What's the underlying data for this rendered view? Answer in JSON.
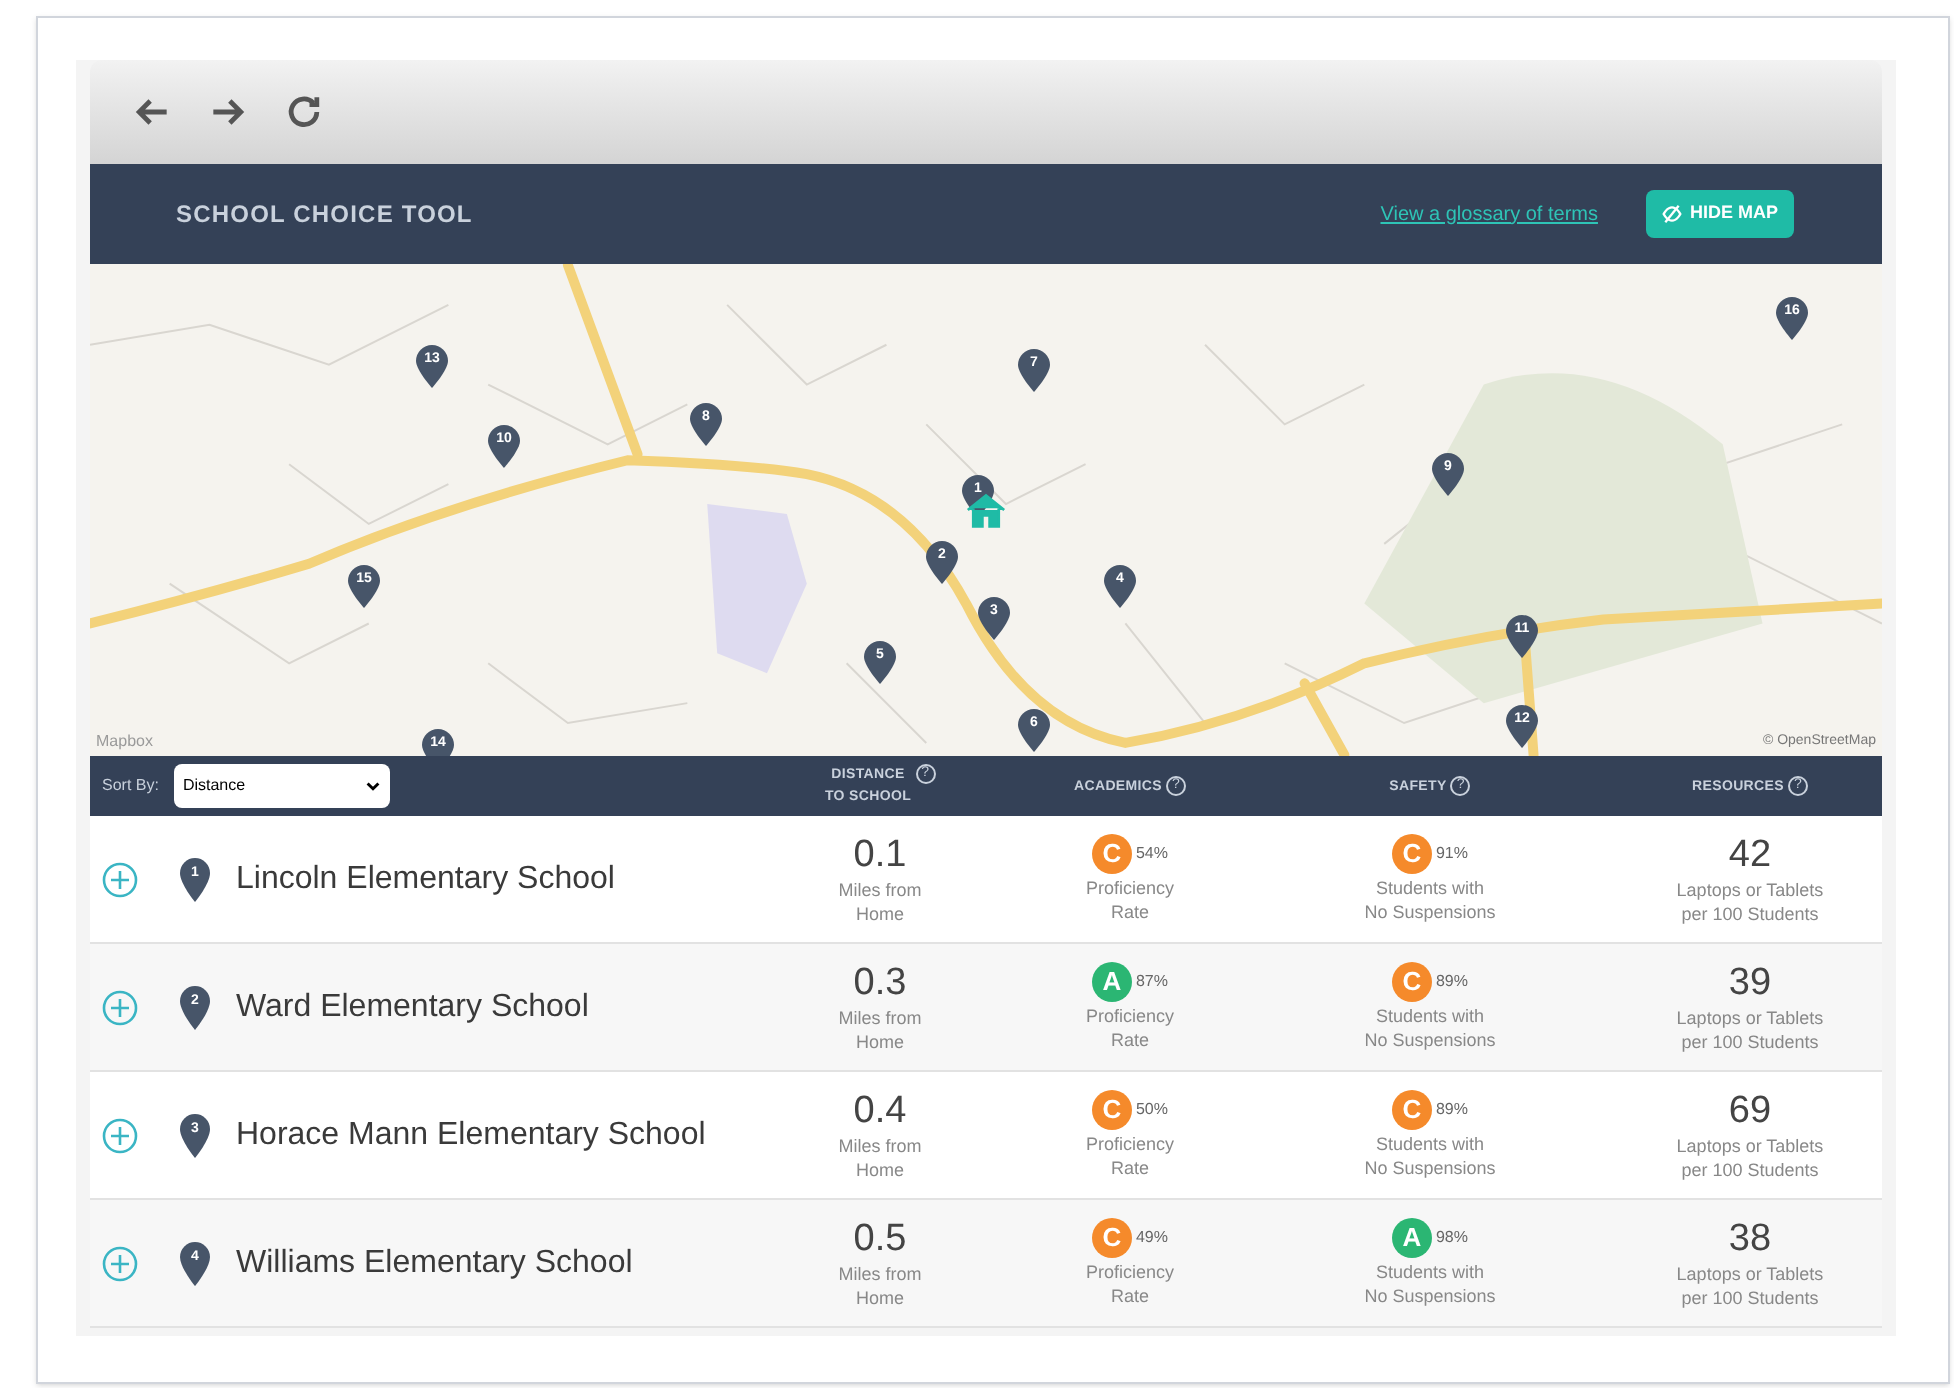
{
  "header": {
    "title": "SCHOOL CHOICE TOOL",
    "glossary_link": "View a glossary of terms",
    "hide_map_button": "HIDE MAP"
  },
  "map": {
    "pins": [
      "1",
      "2",
      "3",
      "4",
      "5",
      "6",
      "7",
      "8",
      "9",
      "10",
      "11",
      "12",
      "13",
      "14",
      "15",
      "16"
    ],
    "attribution_left": "Mapbox",
    "attribution_right": "© OpenStreetMap"
  },
  "table": {
    "sort_label": "Sort By:",
    "sort_value": "Distance",
    "columns": [
      {
        "label": "DISTANCE",
        "label2": "TO SCHOOL",
        "help": "?"
      },
      {
        "label": "ACADEMICS",
        "help": "?"
      },
      {
        "label": "SAFETY",
        "help": "?"
      },
      {
        "label": "RESOURCES",
        "help": "?"
      }
    ],
    "rows": [
      {
        "pin": "1",
        "name": "Lincoln Elementary School",
        "distance": "0.1",
        "distance_caption": [
          "Miles from",
          "Home"
        ],
        "academics": {
          "grade": "C",
          "color": "#f58a2b",
          "percent": "54%",
          "caption": [
            "Proficiency",
            "Rate"
          ]
        },
        "safety": {
          "grade": "C",
          "color": "#f58a2b",
          "percent": "91%",
          "caption": [
            "Students with",
            "No Suspensions"
          ]
        },
        "resources": "42",
        "resources_caption": [
          "Laptops or Tablets",
          "per 100 Students"
        ]
      },
      {
        "pin": "2",
        "name": "Ward Elementary School",
        "distance": "0.3",
        "distance_caption": [
          "Miles from",
          "Home"
        ],
        "academics": {
          "grade": "A",
          "color": "#2bb673",
          "percent": "87%",
          "caption": [
            "Proficiency",
            "Rate"
          ]
        },
        "safety": {
          "grade": "C",
          "color": "#f58a2b",
          "percent": "89%",
          "caption": [
            "Students with",
            "No Suspensions"
          ]
        },
        "resources": "39",
        "resources_caption": [
          "Laptops or Tablets",
          "per 100 Students"
        ]
      },
      {
        "pin": "3",
        "name": "Horace Mann Elementary School",
        "distance": "0.4",
        "distance_caption": [
          "Miles from",
          "Home"
        ],
        "academics": {
          "grade": "C",
          "color": "#f58a2b",
          "percent": "50%",
          "caption": [
            "Proficiency",
            "Rate"
          ]
        },
        "safety": {
          "grade": "C",
          "color": "#f58a2b",
          "percent": "89%",
          "caption": [
            "Students with",
            "No Suspensions"
          ]
        },
        "resources": "69",
        "resources_caption": [
          "Laptops or Tablets",
          "per 100 Students"
        ]
      },
      {
        "pin": "4",
        "name": "Williams Elementary School",
        "distance": "0.5",
        "distance_caption": [
          "Miles from",
          "Home"
        ],
        "academics": {
          "grade": "C",
          "color": "#f58a2b",
          "percent": "49%",
          "caption": [
            "Proficiency",
            "Rate"
          ]
        },
        "safety": {
          "grade": "A",
          "color": "#2bb673",
          "percent": "98%",
          "caption": [
            "Students with",
            "No Suspensions"
          ]
        },
        "resources": "38",
        "resources_caption": [
          "Laptops or Tablets",
          "per 100 Students"
        ]
      }
    ]
  }
}
